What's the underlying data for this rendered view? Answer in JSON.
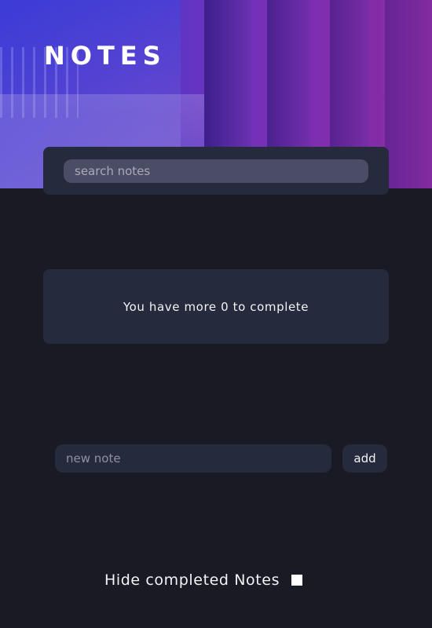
{
  "header": {
    "title": "NOTES"
  },
  "search": {
    "placeholder": "search notes",
    "value": ""
  },
  "summary": {
    "text": "You have more 0 to complete"
  },
  "new_note": {
    "placeholder": "new note",
    "value": "",
    "add_label": "add"
  },
  "filter": {
    "hide_completed_label": "Hide completed Notes",
    "hide_completed_checked": false
  },
  "colors": {
    "background": "#1a1a24",
    "card": "#262a3d",
    "search_field": "#4b4d66",
    "hero_start": "#3a2fd0",
    "hero_end": "#8a2aa0",
    "text": "#f2f2f7"
  }
}
